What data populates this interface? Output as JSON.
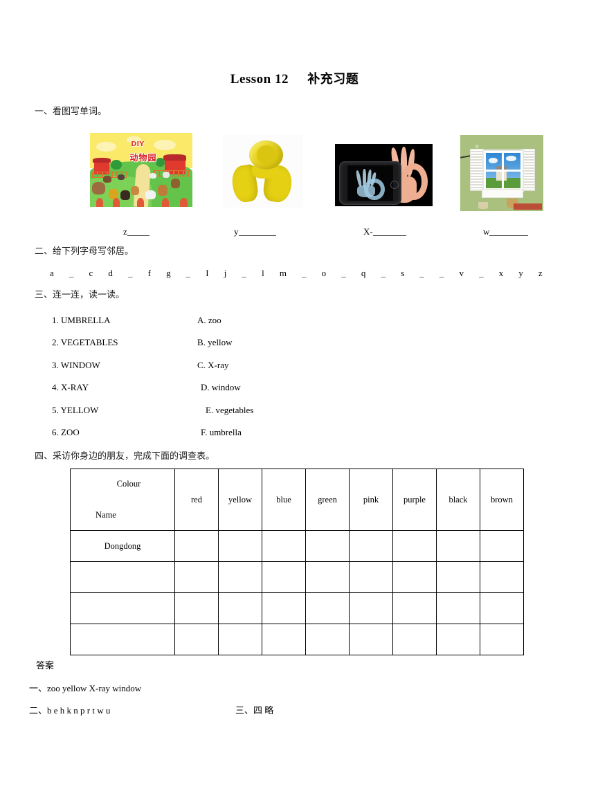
{
  "document": {
    "title_en": "Lesson 12",
    "title_cn": "补充习题"
  },
  "section1": {
    "heading": "一、看图写单词。",
    "pictures": [
      {
        "alt": "cartoon zoo illustration with animals and DIY 动物园 sign",
        "caption_prefix": "z",
        "blank": "____"
      },
      {
        "alt": "yellow scarf on white background",
        "caption_prefix": "y",
        "blank": "______"
      },
      {
        "alt": "smartphone displaying an X-ray of a hand making an OK gesture",
        "caption_prefix": "X-",
        "blank": "_____"
      },
      {
        "alt": "white shuttered window on a green wall showing blue sky",
        "caption_prefix": "w",
        "blank": "______"
      }
    ],
    "zoo_sign_text": "动物园",
    "zoo_sign_diy": "DIY"
  },
  "section2": {
    "heading": "二、给下列字母写邻居。",
    "letters": [
      "a",
      "_",
      "c",
      "d",
      "_",
      "f",
      "g",
      "_",
      "I",
      "j",
      "_",
      "l",
      "m",
      "_",
      "o",
      "_",
      "q",
      "_",
      "s",
      "_",
      "_",
      "v",
      "_",
      "x",
      "y",
      "z"
    ]
  },
  "section3": {
    "heading": "三、连一连，读一读。",
    "left": [
      "1. UMBRELLA",
      "2. VEGETABLES",
      "3. WINDOW",
      "4. X-RAY",
      "5. YELLOW",
      "6. ZOO"
    ],
    "right": [
      "A. zoo",
      "B. yellow",
      "C. X-ray",
      "D. window",
      "E. vegetables",
      "F. umbrella"
    ]
  },
  "section4": {
    "heading": "四、采访你身边的朋友，完成下面的调查表。",
    "table": {
      "corner_colour": "Colour",
      "corner_name": "Name",
      "colours": [
        "red",
        "yellow",
        "blue",
        "green",
        "pink",
        "purple",
        "black",
        "brown"
      ],
      "rows": [
        {
          "name": "Dongdong",
          "cells": [
            "",
            "",
            "",
            "",
            "",
            "",
            "",
            ""
          ]
        },
        {
          "name": "",
          "cells": [
            "",
            "",
            "",
            "",
            "",
            "",
            "",
            ""
          ]
        },
        {
          "name": "",
          "cells": [
            "",
            "",
            "",
            "",
            "",
            "",
            "",
            ""
          ]
        },
        {
          "name": "",
          "cells": [
            "",
            "",
            "",
            "",
            "",
            "",
            "",
            ""
          ]
        }
      ]
    }
  },
  "answers": {
    "title": "答案",
    "line1": "一、zoo    yellow    X-ray    window",
    "line2": "二、b  e  h  k  n  p  r  t  w  u",
    "line3": "三、四 略"
  }
}
